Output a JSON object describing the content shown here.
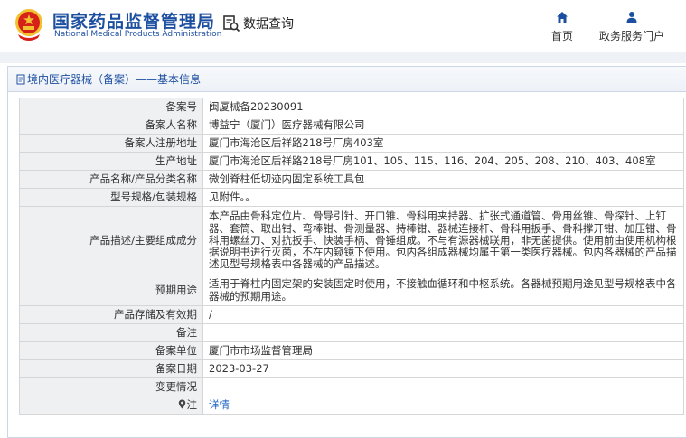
{
  "header": {
    "brand_cn": "国家药品监督管理局",
    "brand_en": "National Medical Products Administration",
    "query_label": "数据查询",
    "nav": [
      {
        "label": "首页",
        "icon": "home-icon"
      },
      {
        "label": "政务服务门户",
        "icon": "user-icon"
      }
    ]
  },
  "panel": {
    "title": "境内医疗器械（备案）——基本信息"
  },
  "records": [
    {
      "key": "备案号",
      "value": "闽厦械备20230091"
    },
    {
      "key": "备案人名称",
      "value": "博益宁（厦门）医疗器械有限公司"
    },
    {
      "key": "备案人注册地址",
      "value": "厦门市海沧区后祥路218号厂房403室"
    },
    {
      "key": "生产地址",
      "value": "厦门市海沧区后祥路218号厂房101、105、115、116、204、205、208、210、403、408室"
    },
    {
      "key": "产品名称/产品分类名称",
      "value": "微创脊柱低切迹内固定系统工具包"
    },
    {
      "key": "型号规格/包装规格",
      "value": "见附件。。"
    },
    {
      "key": "产品描述/主要组成成分",
      "value": "本产品由骨科定位片、骨导引针、开口锥、骨科用夹持器、扩张式通道管、骨用丝锥、骨探针、上钉器、套筒、取出钳、弯棒钳、骨测量器、持棒钳、器械连接杆、骨科用扳手、骨科撑开钳、加压钳、骨科用螺丝刀、对抗扳手、快装手柄、骨锤组成。不与有源器械联用，非无菌提供。使用前由使用机构根据说明书进行灭菌，不在内窥镜下使用。包内各组成器械均属于第一类医疗器械。包内各器械的产品描述见型号规格表中各器械的产品描述。"
    },
    {
      "key": "预期用途",
      "value": "适用于脊柱内固定架的安装固定时使用，不接触血循环和中枢系统。各器械预期用途见型号规格表中各器械的预期用途。"
    },
    {
      "key": "产品存储及有效期",
      "value": "/"
    },
    {
      "key": "备注",
      "value": ""
    },
    {
      "key": "备案单位",
      "value": "厦门市市场监督管理局"
    },
    {
      "key": "备案日期",
      "value": "2023-03-27"
    },
    {
      "key": "变更情况",
      "value": ""
    },
    {
      "key": "注",
      "value": "详情"
    }
  ],
  "colors": {
    "brand_blue": "#1d4fa0",
    "link_blue": "#1d64c4",
    "emblem_red": "#d6201a",
    "emblem_gold": "#f2c12e"
  }
}
